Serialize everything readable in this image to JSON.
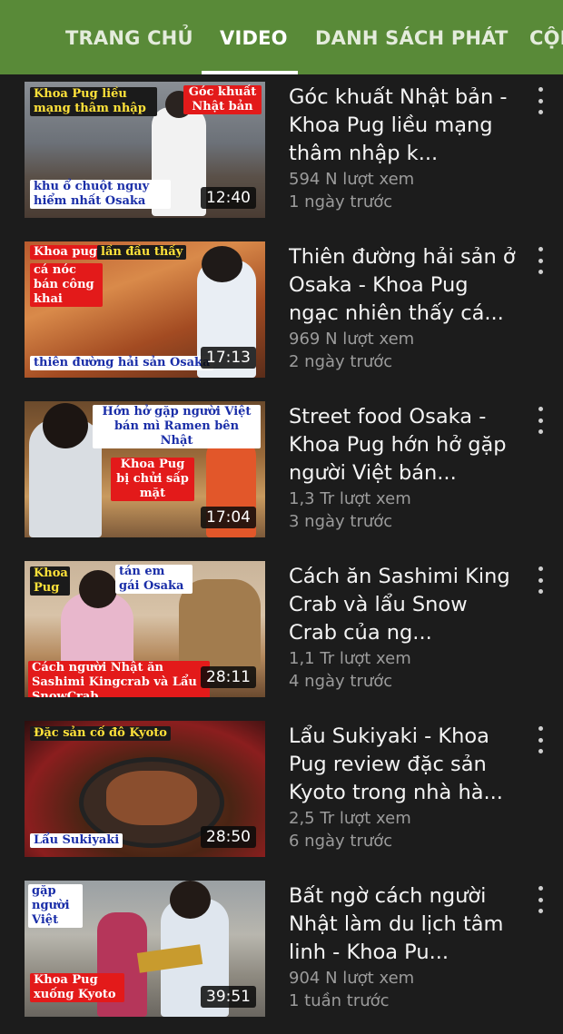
{
  "tabs": [
    {
      "label": "TRANG CHỦ"
    },
    {
      "label": "VIDEO"
    },
    {
      "label": "DANH SÁCH PHÁT"
    },
    {
      "label": "CỘNG"
    }
  ],
  "active_tab": "VIDEO",
  "accent_color": "#598a38",
  "videos": [
    {
      "title": "Góc khuất Nhật bản - Khoa Pug liều mạng thâm nhập k...",
      "views": "594 N lượt xem",
      "age": "1 ngày trước",
      "duration": "12:40",
      "captions": [
        "Khoa Pug liều mạng thâm nhập",
        "Góc khuất Nhật bản",
        "khu ổ chuột nguy hiểm nhất Osaka"
      ]
    },
    {
      "title": "Thiên đường hải sản ở Osaka - Khoa Pug ngạc nhiên thấy cá...",
      "views": "969 N lượt xem",
      "age": "2 ngày trước",
      "duration": "17:13",
      "captions": [
        "Khoa pug",
        "lần đầu thấy",
        "cá nóc bán công khai",
        "thiên đường hải sản Osaka"
      ]
    },
    {
      "title": "Street food Osaka - Khoa Pug hớn hở gặp người Việt bán...",
      "views": "1,3 Tr lượt xem",
      "age": "3 ngày trước",
      "duration": "17:04",
      "captions": [
        "Hớn hở gặp người Việt bán mì Ramen bên Nhật",
        "Khoa Pug bị chửi sấp mặt"
      ]
    },
    {
      "title": "Cách ăn Sashimi King Crab và lẩu Snow Crab của ng...",
      "views": "1,1 Tr lượt xem",
      "age": "4 ngày trước",
      "duration": "28:11",
      "captions": [
        "Khoa Pug",
        "tán em gái Osaka",
        "Cách người Nhật ăn Sashimi Kingcrab và Lẩu SnowCrab"
      ]
    },
    {
      "title": "Lẩu Sukiyaki - Khoa Pug review đặc sản Kyoto trong nhà hà...",
      "views": "2,5 Tr lượt xem",
      "age": "6 ngày trước",
      "duration": "28:50",
      "captions": [
        "Đặc sản cố đô Kyoto",
        "Lẩu Sukiyaki"
      ]
    },
    {
      "title": "Bất ngờ cách người Nhật làm du lịch tâm linh - Khoa Pu...",
      "views": "904 N lượt xem",
      "age": "1 tuần trước",
      "duration": "39:51",
      "captions": [
        "gặp người Việt",
        "Khoa Pug xuống Kyoto"
      ]
    }
  ]
}
